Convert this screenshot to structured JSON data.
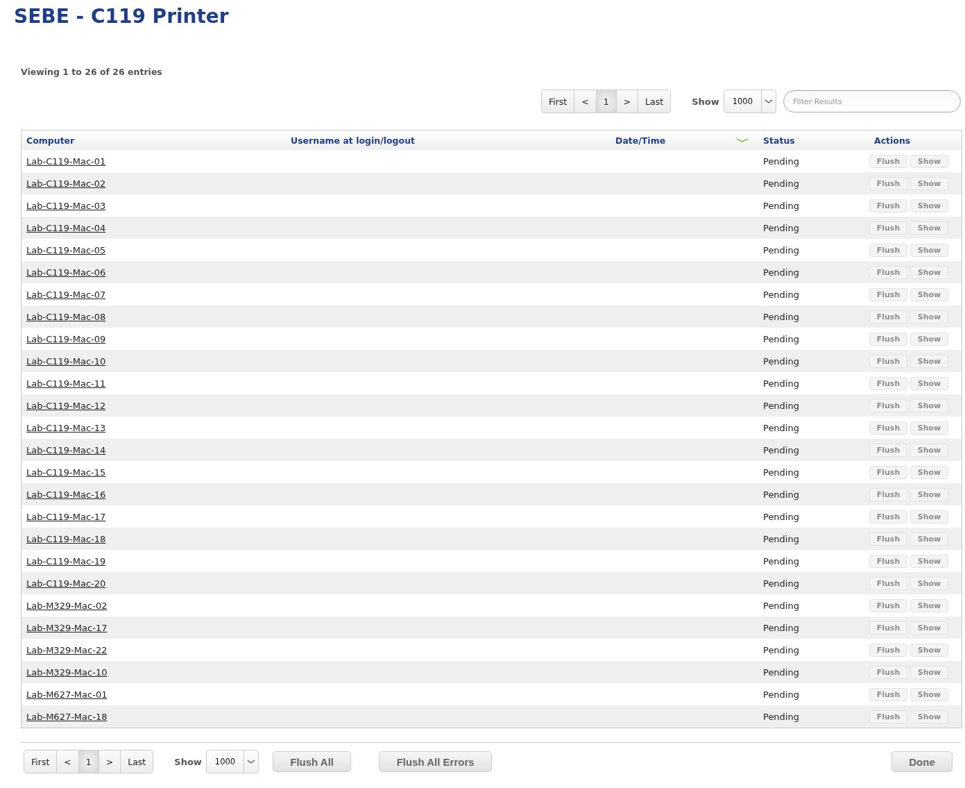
{
  "title": "SEBE - C119 Printer",
  "summary": "Viewing 1 to 26 of 26 entries",
  "top_controls": {
    "pager": [
      {
        "label": "First",
        "selected": false
      },
      {
        "label": "<",
        "selected": false
      },
      {
        "label": "1",
        "selected": true
      },
      {
        "label": ">",
        "selected": false
      },
      {
        "label": "Last",
        "selected": false
      }
    ],
    "show_label": "Show",
    "page_size": "1000",
    "filter": {
      "placeholder": "Filter Results"
    }
  },
  "table": {
    "columns": [
      {
        "label": "Computer",
        "sorted": false
      },
      {
        "label": "Username at login/logout",
        "sorted": false
      },
      {
        "label": "Date/Time",
        "sorted": true
      },
      {
        "label": "Status",
        "sorted": false
      },
      {
        "label": "Actions",
        "sorted": false
      }
    ],
    "rows": [
      {
        "computer": "Lab-C119-Mac-01",
        "status": "Pending",
        "actions": [
          {
            "label": "Flush",
            "disabled": true
          },
          {
            "label": "Show",
            "disabled": true
          }
        ]
      },
      {
        "computer": "Lab-C119-Mac-02",
        "status": "Pending",
        "actions": [
          {
            "label": "Flush",
            "disabled": true
          },
          {
            "label": "Show",
            "disabled": true
          }
        ]
      },
      {
        "computer": "Lab-C119-Mac-03",
        "status": "Pending",
        "actions": [
          {
            "label": "Flush",
            "disabled": true
          },
          {
            "label": "Show",
            "disabled": true
          }
        ]
      },
      {
        "computer": "Lab-C119-Mac-04",
        "status": "Pending",
        "actions": [
          {
            "label": "Flush",
            "disabled": true
          },
          {
            "label": "Show",
            "disabled": true
          }
        ]
      },
      {
        "computer": "Lab-C119-Mac-05",
        "status": "Pending",
        "actions": [
          {
            "label": "Flush",
            "disabled": true
          },
          {
            "label": "Show",
            "disabled": true
          }
        ]
      },
      {
        "computer": "Lab-C119-Mac-06",
        "status": "Pending",
        "actions": [
          {
            "label": "Flush",
            "disabled": true
          },
          {
            "label": "Show",
            "disabled": true
          }
        ]
      },
      {
        "computer": "Lab-C119-Mac-07",
        "status": "Pending",
        "actions": [
          {
            "label": "Flush",
            "disabled": true
          },
          {
            "label": "Show",
            "disabled": true
          }
        ]
      },
      {
        "computer": "Lab-C119-Mac-08",
        "status": "Pending",
        "actions": [
          {
            "label": "Flush",
            "disabled": true
          },
          {
            "label": "Show",
            "disabled": true
          }
        ]
      },
      {
        "computer": "Lab-C119-Mac-09",
        "status": "Pending",
        "actions": [
          {
            "label": "Flush",
            "disabled": true
          },
          {
            "label": "Show",
            "disabled": true
          }
        ]
      },
      {
        "computer": "Lab-C119-Mac-10",
        "status": "Pending",
        "actions": [
          {
            "label": "Flush",
            "disabled": true
          },
          {
            "label": "Show",
            "disabled": true
          }
        ]
      },
      {
        "computer": "Lab-C119-Mac-11",
        "status": "Pending",
        "actions": [
          {
            "label": "Flush",
            "disabled": true
          },
          {
            "label": "Show",
            "disabled": true
          }
        ]
      },
      {
        "computer": "Lab-C119-Mac-12",
        "status": "Pending",
        "actions": [
          {
            "label": "Flush",
            "disabled": true
          },
          {
            "label": "Show",
            "disabled": true
          }
        ]
      },
      {
        "computer": "Lab-C119-Mac-13",
        "status": "Pending",
        "actions": [
          {
            "label": "Flush",
            "disabled": true
          },
          {
            "label": "Show",
            "disabled": true
          }
        ]
      },
      {
        "computer": "Lab-C119-Mac-14",
        "status": "Pending",
        "actions": [
          {
            "label": "Flush",
            "disabled": true
          },
          {
            "label": "Show",
            "disabled": true
          }
        ]
      },
      {
        "computer": "Lab-C119-Mac-15",
        "status": "Pending",
        "actions": [
          {
            "label": "Flush",
            "disabled": true
          },
          {
            "label": "Show",
            "disabled": true
          }
        ]
      },
      {
        "computer": "Lab-C119-Mac-16",
        "status": "Pending",
        "actions": [
          {
            "label": "Flush",
            "disabled": true
          },
          {
            "label": "Show",
            "disabled": true
          }
        ]
      },
      {
        "computer": "Lab-C119-Mac-17",
        "status": "Pending",
        "actions": [
          {
            "label": "Flush",
            "disabled": true
          },
          {
            "label": "Show",
            "disabled": true
          }
        ]
      },
      {
        "computer": "Lab-C119-Mac-18",
        "status": "Pending",
        "actions": [
          {
            "label": "Flush",
            "disabled": true
          },
          {
            "label": "Show",
            "disabled": true
          }
        ]
      },
      {
        "computer": "Lab-C119-Mac-19",
        "status": "Pending",
        "actions": [
          {
            "label": "Flush",
            "disabled": true
          },
          {
            "label": "Show",
            "disabled": true
          }
        ]
      },
      {
        "computer": "Lab-C119-Mac-20",
        "status": "Pending",
        "actions": [
          {
            "label": "Flush",
            "disabled": true
          },
          {
            "label": "Show",
            "disabled": true
          }
        ]
      },
      {
        "computer": "Lab-M329-Mac-02",
        "status": "Pending",
        "actions": [
          {
            "label": "Flush",
            "disabled": true
          },
          {
            "label": "Show",
            "disabled": true
          }
        ]
      },
      {
        "computer": "Lab-M329-Mac-17",
        "status": "Pending",
        "actions": [
          {
            "label": "Flush",
            "disabled": true
          },
          {
            "label": "Show",
            "disabled": true
          }
        ]
      },
      {
        "computer": "Lab-M329-Mac-22",
        "status": "Pending",
        "actions": [
          {
            "label": "Flush",
            "disabled": true
          },
          {
            "label": "Show",
            "disabled": true
          }
        ]
      },
      {
        "computer": "Lab-M329-Mac-10",
        "status": "Pending",
        "actions": [
          {
            "label": "Flush",
            "disabled": true
          },
          {
            "label": "Show",
            "disabled": true
          }
        ]
      },
      {
        "computer": "Lab-M627-Mac-01",
        "status": "Pending",
        "actions": [
          {
            "label": "Flush",
            "disabled": true
          },
          {
            "label": "Show",
            "disabled": true
          }
        ]
      },
      {
        "computer": "Lab-M627-Mac-18",
        "status": "Pending",
        "actions": [
          {
            "label": "Flush",
            "disabled": true
          },
          {
            "label": "Show",
            "disabled": true
          }
        ]
      }
    ]
  },
  "bottom_controls": {
    "pager": [
      {
        "label": "First",
        "selected": false
      },
      {
        "label": "<",
        "selected": false
      },
      {
        "label": "1",
        "selected": true
      },
      {
        "label": ">",
        "selected": false
      },
      {
        "label": "Last",
        "selected": false
      }
    ],
    "show_label": "Show",
    "page_size": "1000",
    "buttons": [
      "Flush All",
      "Flush All Errors"
    ],
    "done": "Done"
  }
}
